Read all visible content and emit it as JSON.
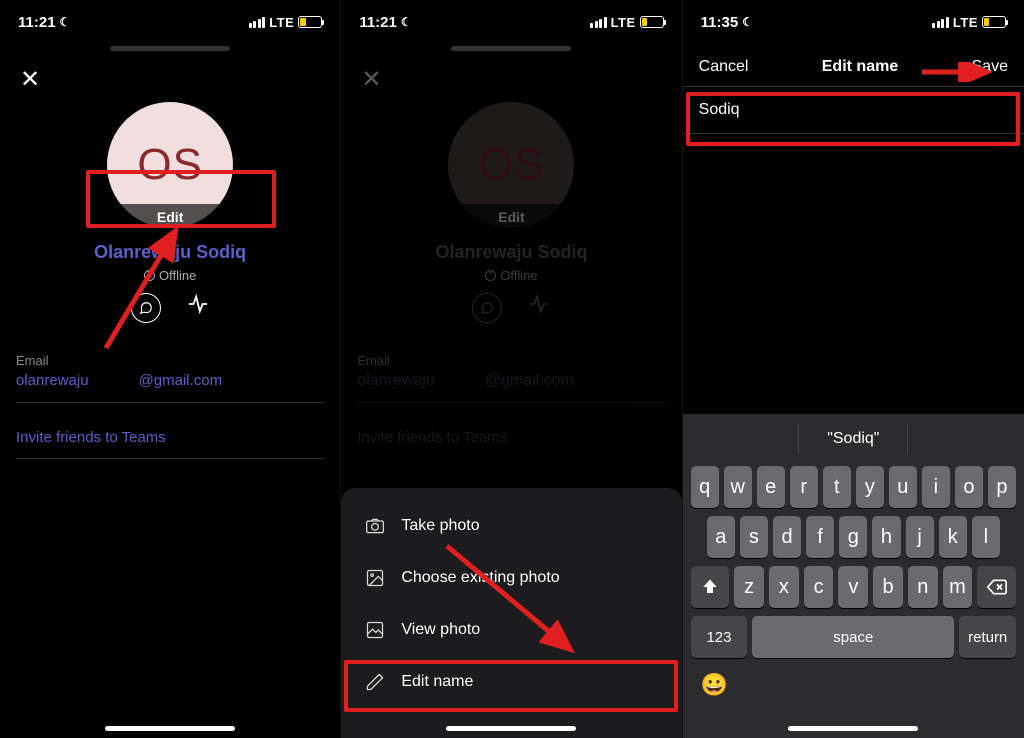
{
  "status": {
    "time1": "11:21",
    "time2": "11:21",
    "time3": "11:35",
    "network": "LTE",
    "battery1": "29",
    "battery2": "29",
    "battery3": "27"
  },
  "profile": {
    "initials": "OS",
    "edit_label": "Edit",
    "name": "Olanrewaju Sodiq",
    "status_text": "Offline",
    "email_label": "Email",
    "email_user": "olanrewaju",
    "email_domain": "@gmail.com",
    "invite_label": "Invite friends to Teams"
  },
  "sheet": {
    "take_photo": "Take photo",
    "choose_photo": "Choose existing photo",
    "view_photo": "View photo",
    "edit_name": "Edit name"
  },
  "edit_screen": {
    "cancel": "Cancel",
    "title": "Edit name",
    "save": "Save",
    "input_value": "Sodiq"
  },
  "keyboard": {
    "suggestion": "\"Sodiq\"",
    "row1": [
      "q",
      "w",
      "e",
      "r",
      "t",
      "y",
      "u",
      "i",
      "o",
      "p"
    ],
    "row2": [
      "a",
      "s",
      "d",
      "f",
      "g",
      "h",
      "j",
      "k",
      "l"
    ],
    "row3": [
      "z",
      "x",
      "c",
      "v",
      "b",
      "n",
      "m"
    ],
    "num_key": "123",
    "space_key": "space",
    "return_key": "return"
  }
}
